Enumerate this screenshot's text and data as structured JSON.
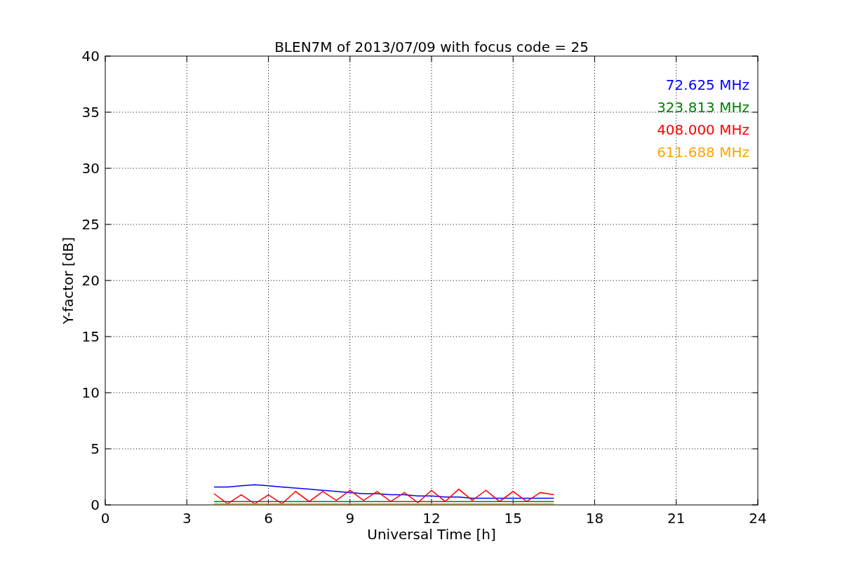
{
  "chart_data": {
    "type": "line",
    "title": "BLEN7M of 2013/07/09 with focus code = 25",
    "xlabel": "Universal Time [h]",
    "ylabel": "Y-factor [dB]",
    "x": [
      4,
      4.5,
      5,
      5.5,
      6,
      6.5,
      7,
      7.5,
      8,
      8.5,
      9,
      9.5,
      10,
      10.5,
      11,
      11.5,
      12,
      12.5,
      13,
      13.5,
      14,
      14.5,
      15,
      15.5,
      16,
      16.5
    ],
    "series": [
      {
        "name": "72.625 MHz",
        "color": "#0000ff",
        "values": [
          1.6,
          1.6,
          1.7,
          1.8,
          1.7,
          1.6,
          1.5,
          1.4,
          1.3,
          1.2,
          1.1,
          1.0,
          1.0,
          0.9,
          0.9,
          0.8,
          0.8,
          0.7,
          0.7,
          0.6,
          0.6,
          0.6,
          0.6,
          0.6,
          0.6,
          0.6
        ]
      },
      {
        "name": "323.813 MHz",
        "color": "#008000",
        "values": [
          0.3,
          0.3,
          0.3,
          0.3,
          0.3,
          0.3,
          0.3,
          0.3,
          0.3,
          0.3,
          0.3,
          0.3,
          0.3,
          0.3,
          0.3,
          0.3,
          0.3,
          0.3,
          0.3,
          0.3,
          0.3,
          0.3,
          0.3,
          0.3,
          0.3,
          0.3
        ]
      },
      {
        "name": "408.000 MHz",
        "color": "#ff0000",
        "values": [
          1.0,
          0.1,
          0.9,
          0.1,
          0.9,
          0.1,
          1.2,
          0.3,
          1.2,
          0.4,
          1.3,
          0.4,
          1.2,
          0.3,
          1.1,
          0.2,
          1.3,
          0.3,
          1.4,
          0.4,
          1.3,
          0.3,
          1.2,
          0.3,
          1.1,
          0.9
        ]
      },
      {
        "name": "611.688 MHz",
        "color": "#ffa500",
        "values": [
          0.1,
          0.1,
          0.1,
          0.1,
          0.1,
          0.1,
          0.1,
          0.1,
          0.1,
          0.1,
          0.1,
          0.1,
          0.1,
          0.1,
          0.1,
          0.1,
          0.1,
          0.1,
          0.1,
          0.1,
          0.1,
          0.1,
          0.1,
          0.1,
          0.1,
          0.1
        ]
      }
    ],
    "grid": true,
    "xlim": [
      0,
      24
    ],
    "ylim": [
      0,
      40
    ],
    "xticks": [
      0,
      3,
      6,
      9,
      12,
      15,
      18,
      21,
      24
    ],
    "yticks": [
      0,
      5,
      10,
      15,
      20,
      25,
      30,
      35,
      40
    ]
  }
}
